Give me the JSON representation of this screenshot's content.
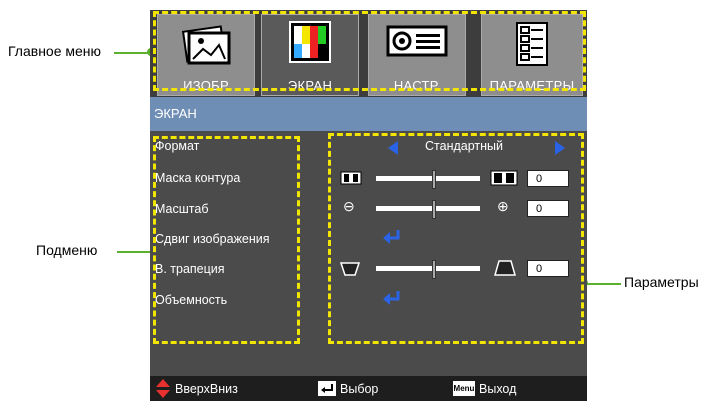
{
  "callouts": {
    "main_menu": "Главное меню",
    "submenu": "Подменю",
    "parameters": "Параметры"
  },
  "tabs": [
    {
      "label": "ИЗОБР",
      "icon": "image-icon"
    },
    {
      "label": "ЭКРАН",
      "icon": "color-bars-icon",
      "active": true
    },
    {
      "label": "НАСТР.",
      "icon": "projector-icon"
    },
    {
      "label": "ПАРАМЕТРЫ",
      "icon": "document-icon"
    }
  ],
  "section_title": "ЭКРАН",
  "menu": {
    "items": [
      "Формат",
      "Маска контура",
      "Масштаб",
      "Сдвиг изображения",
      "В. трапеция",
      "Объемность"
    ]
  },
  "values": {
    "format": "Стандартный",
    "edge_mask": "0",
    "zoom": "0",
    "v_keystone": "0"
  },
  "footer": {
    "updown": "ВверхВниз",
    "select": "Выбор",
    "menu_key": "Menu",
    "exit": "Выход"
  },
  "colors": {
    "accent_blue": "#2a63e6",
    "highlight_yellow": "#f2e600",
    "callout_green": "#5bb02e",
    "arrow_red": "#e8302e"
  }
}
